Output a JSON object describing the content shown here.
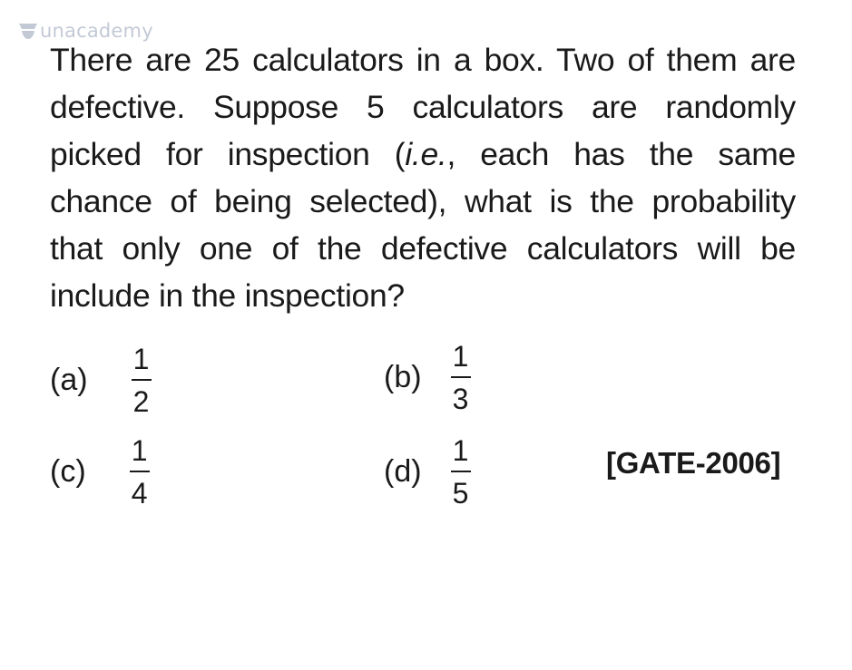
{
  "watermark": {
    "brand": "unacademy",
    "icon": "unacademy-logo-icon"
  },
  "question": {
    "lines": [
      "There are 25 calculators in a box. Two of them are",
      "defective. Suppose 5 calculators are randomly",
      "picked for inspection (i.e., each has the same",
      "chance of being selected), what is the probability",
      "that only one of the defective calculators will be",
      "include in the inspection?"
    ],
    "italic_phrase": "i.e."
  },
  "options": [
    {
      "label": "(a)",
      "numerator": "1",
      "denominator": "2"
    },
    {
      "label": "(b)",
      "numerator": "1",
      "denominator": "3"
    },
    {
      "label": "(c)",
      "numerator": "1",
      "denominator": "4"
    },
    {
      "label": "(d)",
      "numerator": "1",
      "denominator": "5"
    }
  ],
  "source": "[GATE-2006]"
}
